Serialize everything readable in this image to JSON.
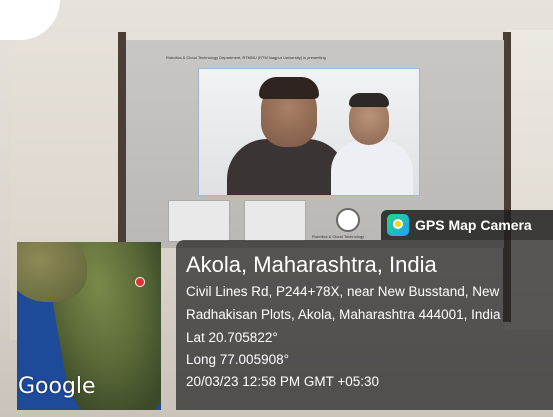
{
  "gps_app": {
    "name": "GPS Map Camera",
    "icon": "gps-map-camera-icon"
  },
  "location": {
    "title": "Akola, Maharashtra, India",
    "address_line_1": "Civil Lines Rd, P244+78X, near New Busstand, New",
    "address_line_2": "Radhakisan Plots, Akola, Maharashtra 444001, India",
    "lat": "Lat 20.705822°",
    "long": "Long 77.005908°",
    "timestamp": "20/03/23 12:58 PM GMT +05:30"
  },
  "map": {
    "provider": "Google"
  },
  "screen": {
    "topbar_text": "Robotics & Cloud Technology Department, RTMNU (RTM Nagpur University) is presenting",
    "thumb_label": "Robotics & Cloud Technology"
  }
}
